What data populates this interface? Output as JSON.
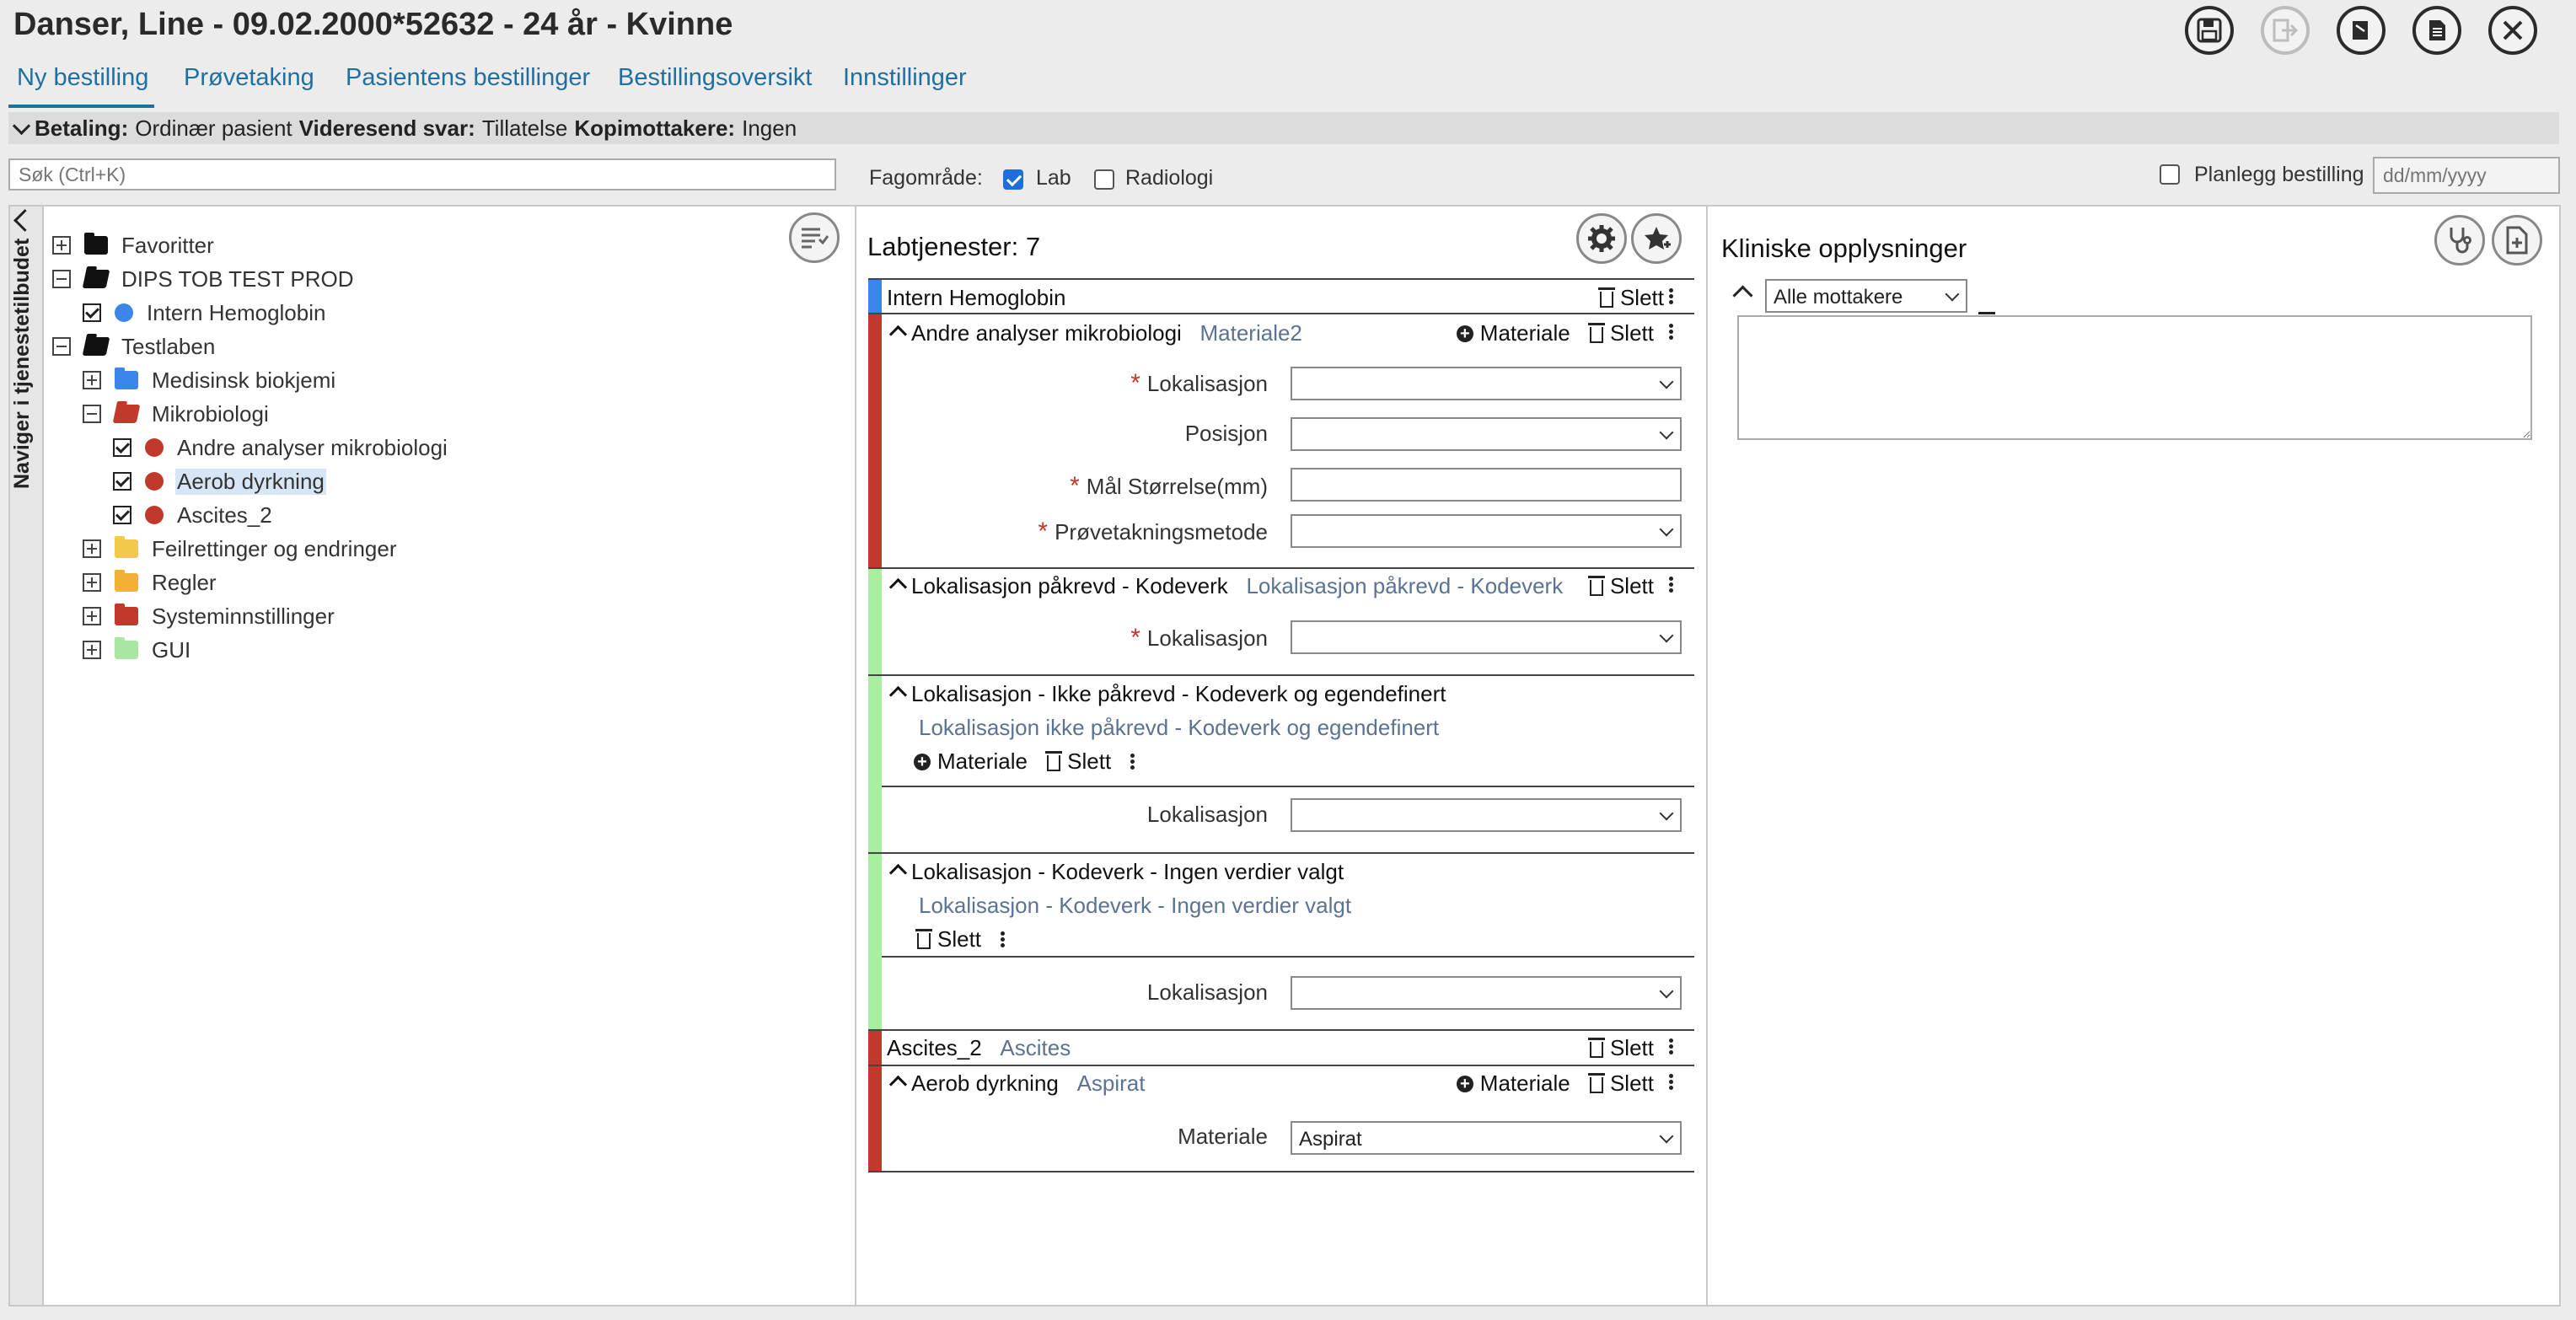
{
  "patient": {
    "title": "Danser, Line - 09.02.2000*52632 - 24 år - Kvinne"
  },
  "toolbar_icons": [
    "save-icon",
    "export-icon",
    "book-icon",
    "document-icon",
    "close-icon"
  ],
  "tabs": [
    {
      "label": "Ny bestilling",
      "active": true
    },
    {
      "label": "Prøvetaking"
    },
    {
      "label": "Pasientens bestillinger"
    },
    {
      "label": "Bestillingsoversikt"
    },
    {
      "label": "Innstillinger"
    }
  ],
  "infobar": {
    "betaling_label": "Betaling:",
    "betaling_value": "Ordinær pasient",
    "videresend_label": "Videresend svar:",
    "videresend_value": "Tillatelse",
    "kopi_label": "Kopimottakere:",
    "kopi_value": "Ingen"
  },
  "search": {
    "placeholder": "Søk (Ctrl+K)"
  },
  "fagomrade": {
    "label": "Fagområde:",
    "lab_label": "Lab",
    "lab_checked": true,
    "radiologi_label": "Radiologi",
    "radiologi_checked": false
  },
  "plan": {
    "label": "Planlegg bestilling",
    "date_placeholder": "dd/mm/yyyy"
  },
  "sidebar": {
    "label": "Naviger i tjenestetilbudet"
  },
  "tree": [
    {
      "label": "Favoritter",
      "toggle": "plus",
      "icon": "folder",
      "color": "#111111"
    },
    {
      "label": "DIPS TOB TEST PROD",
      "toggle": "minus",
      "icon": "folder-open",
      "color": "#111111"
    },
    {
      "label": "Intern Hemoglobin",
      "checked": true,
      "icon": "dot",
      "color": "#3b86e8"
    },
    {
      "label": "Testlaben",
      "toggle": "minus",
      "icon": "folder-open",
      "color": "#111111"
    },
    {
      "label": "Medisinsk biokjemi",
      "toggle": "plus",
      "icon": "folder",
      "color": "#3b86e8"
    },
    {
      "label": "Mikrobiologi",
      "toggle": "minus",
      "icon": "folder-open",
      "color": "#c0392b"
    },
    {
      "label": "Andre analyser mikrobiologi",
      "checked": true,
      "icon": "dot",
      "color": "#c0392b"
    },
    {
      "label": "Aerob dyrkning",
      "checked": true,
      "icon": "dot",
      "color": "#c0392b",
      "highlight": true
    },
    {
      "label": "Ascites_2",
      "checked": true,
      "icon": "dot",
      "color": "#c0392b"
    },
    {
      "label": "Feilrettinger og endringer",
      "toggle": "plus",
      "icon": "folder",
      "color": "#f2c94c"
    },
    {
      "label": "Regler",
      "toggle": "plus",
      "icon": "folder",
      "color": "#f2b134"
    },
    {
      "label": "Systeminnstillinger",
      "toggle": "plus",
      "icon": "folder",
      "color": "#c0392b"
    },
    {
      "label": "GUI",
      "toggle": "plus",
      "icon": "folder",
      "color": "#a8e6a1"
    }
  ],
  "labtjenester": {
    "title": "Labtjenester: 7"
  },
  "common": {
    "slett": "Slett",
    "materiale": "Materiale"
  },
  "orders": {
    "intern": {
      "name": "Intern Hemoglobin"
    },
    "andre": {
      "name": "Andre analyser mikrobiologi",
      "sub": "Materiale2",
      "fields": [
        "Lokalisasjon",
        "Posisjon",
        "Mål Størrelse(mm)",
        "Prøvetakningsmetode"
      ]
    },
    "lok_pakrevd": {
      "name": "Lokalisasjon påkrevd - Kodeverk",
      "sub": "Lokalisasjon påkrevd - Kodeverk",
      "field": "Lokalisasjon"
    },
    "lok_ikke": {
      "name": "Lokalisasjon - Ikke påkrevd - Kodeverk og egendefinert",
      "sub": "Lokalisasjon ikke påkrevd - Kodeverk og egendefinert",
      "field": "Lokalisasjon"
    },
    "lok_ingen": {
      "name": "Lokalisasjon - Kodeverk - Ingen verdier valgt",
      "sub": "Lokalisasjon - Kodeverk - Ingen verdier valgt",
      "field": "Lokalisasjon"
    },
    "ascites": {
      "name": "Ascites_2",
      "sub": "Ascites"
    },
    "aerob": {
      "name": "Aerob dyrkning",
      "sub": "Aspirat",
      "field": "Materiale",
      "value": "Aspirat"
    }
  },
  "kliniske": {
    "title": "Kliniske opplysninger",
    "recipient": "Alle mottakere"
  },
  "colors": {
    "red": "#c0392b",
    "green": "#a8f0a0",
    "blue": "#3b86e8",
    "accent": "#1f6fa0"
  }
}
